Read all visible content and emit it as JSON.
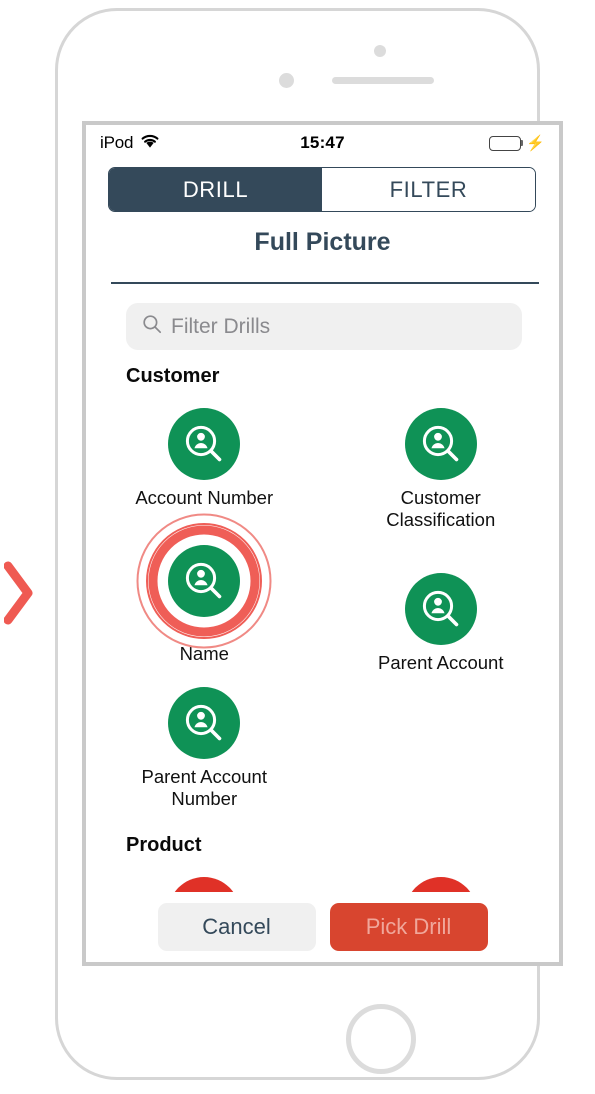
{
  "status_bar": {
    "carrier": "iPod",
    "wifi_icon": "wifi-icon",
    "time": "15:47",
    "battery_icon": "battery-full-icon",
    "charging_icon": "lightning-bolt-icon"
  },
  "segmented_control": {
    "active": "DRILL",
    "tabs": [
      {
        "label": "DRILL",
        "active": true
      },
      {
        "label": "FILTER",
        "active": false
      }
    ]
  },
  "header": {
    "title": "Full Picture"
  },
  "search": {
    "icon": "search-icon",
    "placeholder": "Filter Drills",
    "value": ""
  },
  "sections": [
    {
      "title": "Customer",
      "items": [
        {
          "label": "Account Number",
          "icon": "person-search-icon",
          "color": "#0f9256",
          "highlighted": false
        },
        {
          "label": "Customer\nClassification",
          "icon": "person-search-icon",
          "color": "#0f9256",
          "highlighted": false
        },
        {
          "label": "Name",
          "icon": "person-search-icon",
          "color": "#0f9256",
          "highlighted": true
        },
        {
          "label": "Parent Account",
          "icon": "person-search-icon",
          "color": "#0f9256",
          "highlighted": false
        },
        {
          "label": "Parent Account\nNumber",
          "icon": "person-search-icon",
          "color": "#0f9256",
          "highlighted": false
        }
      ]
    },
    {
      "title": "Product",
      "items": [
        {
          "label": "",
          "icon": "person-search-icon",
          "color": "#e03127",
          "highlighted": false
        },
        {
          "label": "",
          "icon": "person-search-icon",
          "color": "#e03127",
          "highlighted": false
        }
      ]
    }
  ],
  "footer": {
    "cancel_label": "Cancel",
    "pick_drill_label": "Pick Drill"
  },
  "annotation": {
    "chevron_icon": "chevron-right-icon",
    "chevron_color": "#ef5a52",
    "highlight_ring_color": "#ef5e57"
  },
  "labels": {
    "customer_section": "Customer",
    "product_section": "Product",
    "item_account_number": "Account Number",
    "item_customer_classification_line1": "Customer",
    "item_customer_classification_line2": "Classification",
    "item_name": "Name",
    "item_parent_account": "Parent Account",
    "item_parent_account_number_line1": "Parent Account",
    "item_parent_account_number_line2": "Number"
  }
}
